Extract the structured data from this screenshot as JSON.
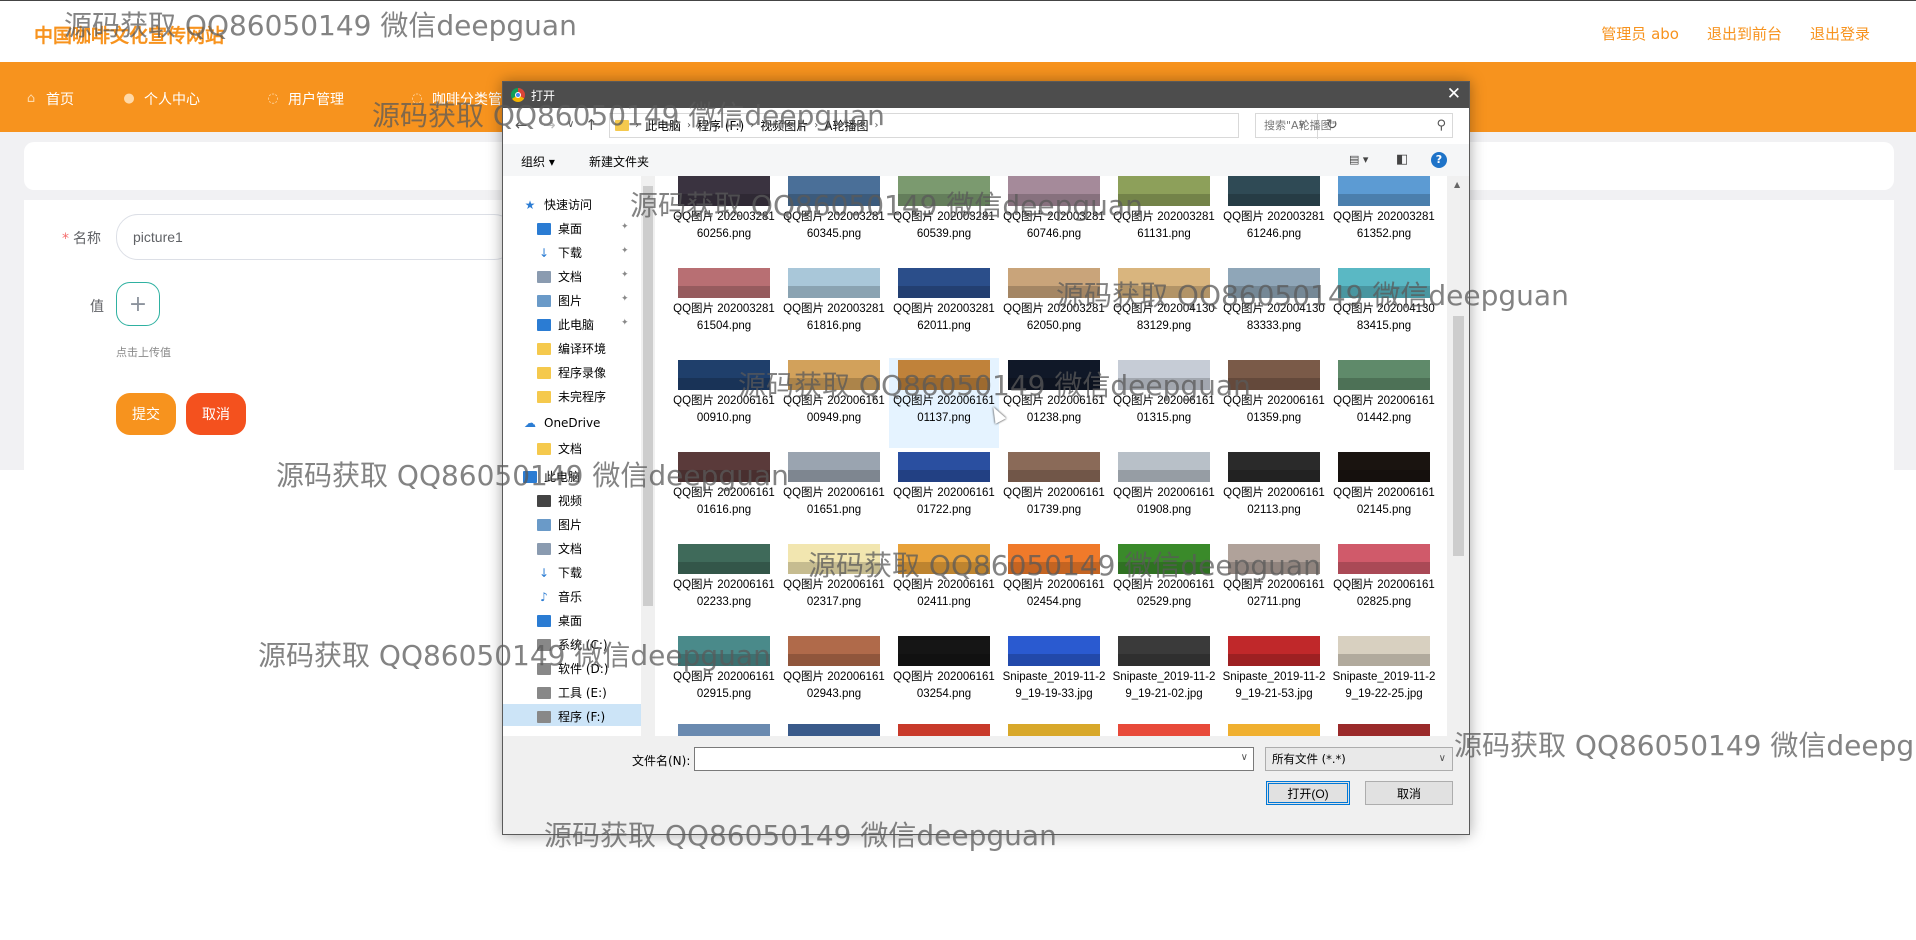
{
  "app": {
    "site_title": "中国咖啡文化宣传网站",
    "top_links": [
      "管理员 abo",
      "退出到前台",
      "退出登录"
    ],
    "nav": [
      "首页",
      "个人中心",
      "用户管理",
      "咖啡分类管理"
    ],
    "brand_color": "#f7931e"
  },
  "form": {
    "name_label": "名称",
    "name_value": "picture1",
    "value_label": "值",
    "upload_plus": "+",
    "upload_hint": "点击上传值",
    "submit_label": "提交",
    "cancel_label": "取消"
  },
  "dialog": {
    "title": "打开",
    "close": "✕",
    "path": [
      "此电脑",
      "程序 (F:)",
      "视频图片",
      "A轮播图"
    ],
    "search_placeholder": "搜索\"A轮播图\"",
    "organize": "组织 ▾",
    "new_folder": "新建文件夹",
    "tree": [
      {
        "label": "快速访问",
        "icon": "star-icon",
        "pinned": false
      },
      {
        "label": "桌面",
        "icon": "desktop-icon",
        "pinned": true
      },
      {
        "label": "下载",
        "icon": "download-icon",
        "pinned": true
      },
      {
        "label": "文档",
        "icon": "document-icon",
        "pinned": true
      },
      {
        "label": "图片",
        "icon": "pictures-icon",
        "pinned": true
      },
      {
        "label": "此电脑",
        "icon": "computer-icon",
        "pinned": true
      },
      {
        "label": "编译环境",
        "icon": "folder-icon",
        "pinned": false
      },
      {
        "label": "程序录像",
        "icon": "folder-icon",
        "pinned": false
      },
      {
        "label": "未完程序",
        "icon": "folder-icon",
        "pinned": false
      },
      {
        "label": "OneDrive",
        "icon": "cloud-icon",
        "pinned": false
      },
      {
        "label": "文档",
        "icon": "folder-icon",
        "pinned": false
      },
      {
        "label": "此电脑",
        "icon": "computer-icon",
        "pinned": false
      },
      {
        "label": "视频",
        "icon": "video-icon",
        "pinned": false
      },
      {
        "label": "图片",
        "icon": "pictures-icon",
        "pinned": false
      },
      {
        "label": "文档",
        "icon": "document-icon",
        "pinned": false
      },
      {
        "label": "下载",
        "icon": "download-icon",
        "pinned": false
      },
      {
        "label": "音乐",
        "icon": "music-icon",
        "pinned": false
      },
      {
        "label": "桌面",
        "icon": "desktop-icon",
        "pinned": false
      },
      {
        "label": "系统 (C:)",
        "icon": "drive-icon",
        "pinned": false
      },
      {
        "label": "软件 (D:)",
        "icon": "drive-icon",
        "pinned": false
      },
      {
        "label": "工具 (E:)",
        "icon": "drive-icon",
        "pinned": false
      },
      {
        "label": "程序 (F:)",
        "icon": "drive-icon",
        "pinned": false,
        "selected": true
      }
    ],
    "files": [
      {
        "name": "QQ图片 20200328160256.png",
        "color": "#3a3340"
      },
      {
        "name": "QQ图片 20200328160345.png",
        "color": "#4a6f98"
      },
      {
        "name": "QQ图片 20200328160539.png",
        "color": "#7b9a6f"
      },
      {
        "name": "QQ图片 20200328160746.png",
        "color": "#a58a9a"
      },
      {
        "name": "QQ图片 20200328161131.png",
        "color": "#8da05a"
      },
      {
        "name": "QQ图片 20200328161246.png",
        "color": "#2f4a55"
      },
      {
        "name": "QQ图片 20200328161352.png",
        "color": "#5c9bd3"
      },
      {
        "name": "QQ图片 20200328161504.png",
        "color": "#b86f73"
      },
      {
        "name": "QQ图片 20200328161816.png",
        "color": "#a9c7d9"
      },
      {
        "name": "QQ图片 20200328162011.png",
        "color": "#2b4e8a"
      },
      {
        "name": "QQ图片 20200328162050.png",
        "color": "#c9a47a"
      },
      {
        "name": "QQ图片 20200413083129.png",
        "color": "#d9b57e"
      },
      {
        "name": "QQ图片 20200413083333.png",
        "color": "#8fa6b8"
      },
      {
        "name": "QQ图片 20200413083415.png",
        "color": "#5ab8c4"
      },
      {
        "name": "QQ图片 20200616100910.png",
        "color": "#1f3f6b"
      },
      {
        "name": "QQ图片 20200616100949.png",
        "color": "#d2a15b"
      },
      {
        "name": "QQ图片 20200616101137.png",
        "color": "#c0823a"
      },
      {
        "name": "QQ图片 20200616101238.png",
        "color": "#101828"
      },
      {
        "name": "QQ图片 20200616101315.png",
        "color": "#c6ccd6"
      },
      {
        "name": "QQ图片 20200616101359.png",
        "color": "#7a5a48"
      },
      {
        "name": "QQ图片 20200616101442.png",
        "color": "#5f8a6a"
      },
      {
        "name": "QQ图片 20200616101616.png",
        "color": "#5a3a3a"
      },
      {
        "name": "QQ图片 20200616101651.png",
        "color": "#9aa4b0"
      },
      {
        "name": "QQ图片 20200616101722.png",
        "color": "#2a4fa0"
      },
      {
        "name": "QQ图片 20200616101739.png",
        "color": "#8a6a58"
      },
      {
        "name": "QQ图片 20200616101908.png",
        "color": "#b8c0c8"
      },
      {
        "name": "QQ图片 20200616102113.png",
        "color": "#2a2a2a"
      },
      {
        "name": "QQ图片 20200616102145.png",
        "color": "#1a1410"
      },
      {
        "name": "QQ图片 20200616102233.png",
        "color": "#3f6a5a"
      },
      {
        "name": "QQ图片 20200616102317.png",
        "color": "#f2e6b0"
      },
      {
        "name": "QQ图片 20200616102411.png",
        "color": "#e8a23a"
      },
      {
        "name": "QQ图片 20200616102454.png",
        "color": "#f07a2a"
      },
      {
        "name": "QQ图片 20200616102529.png",
        "color": "#3a8a2a"
      },
      {
        "name": "QQ图片 20200616102711.png",
        "color": "#b0a29a"
      },
      {
        "name": "QQ图片 20200616102825.png",
        "color": "#d05a6a"
      },
      {
        "name": "QQ图片 20200616102915.png",
        "color": "#4a8a8a"
      },
      {
        "name": "QQ图片 20200616102943.png",
        "color": "#b06a4a"
      },
      {
        "name": "QQ图片 20200616103254.png",
        "color": "#151515"
      },
      {
        "name": "Snipaste_2019-11-29_19-19-33.jpg",
        "color": "#2a5ad0"
      },
      {
        "name": "Snipaste_2019-11-29_19-21-02.jpg",
        "color": "#3a3a3a"
      },
      {
        "name": "Snipaste_2019-11-29_19-21-53.jpg",
        "color": "#c0282a"
      },
      {
        "name": "Snipaste_2019-11-29_19-22-25.jpg",
        "color": "#d8d0c0"
      }
    ],
    "selected_file_index": 16,
    "filename_label": "文件名(N):",
    "filename_value": "",
    "filetype": "所有文件 (*.*)",
    "open_label": "打开(O)",
    "cancel_label": "取消"
  },
  "watermark": "源码获取 QQ86050149 微信deepguan"
}
